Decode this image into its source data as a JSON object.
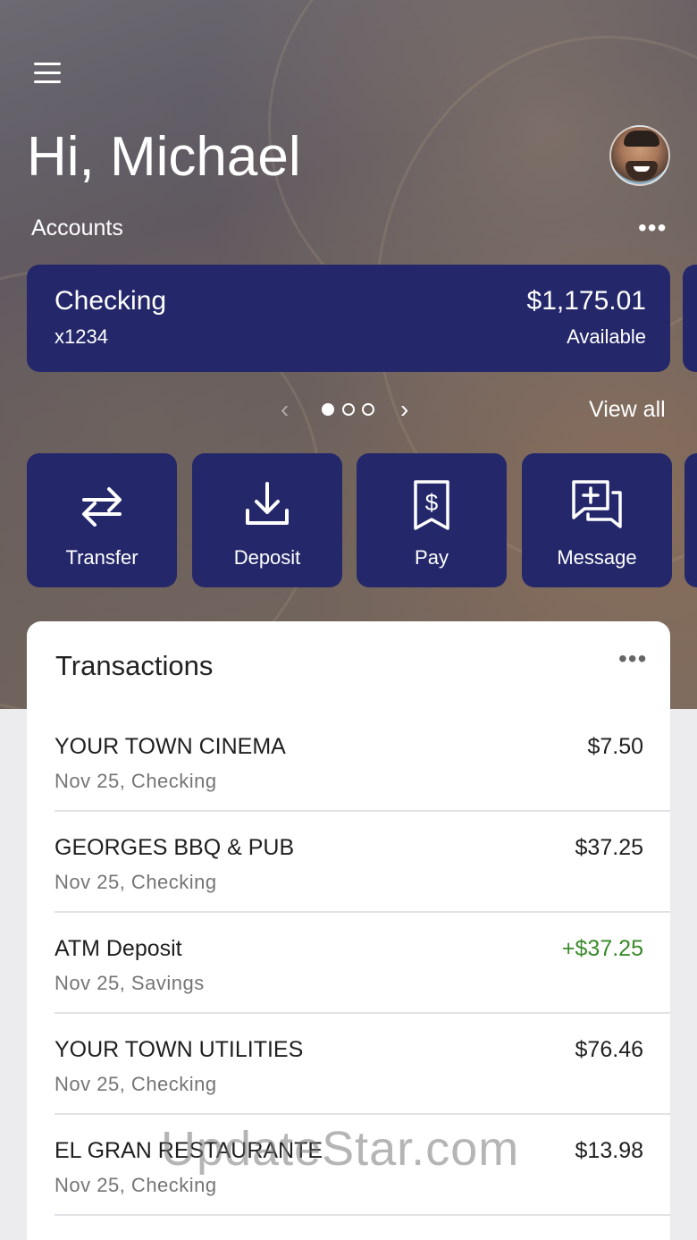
{
  "header": {
    "greeting": "Hi, Michael",
    "menu_icon": "hamburger-menu-icon",
    "avatar_icon": "profile-avatar"
  },
  "accounts": {
    "label": "Accounts",
    "more_icon": "more-horizontal-icon",
    "current": {
      "name": "Checking",
      "number": "x1234",
      "balance": "$1,175.01",
      "balance_label": "Available"
    },
    "pager": {
      "page": 1,
      "total": 3
    },
    "view_all": "View all"
  },
  "actions": [
    {
      "label": "Transfer",
      "icon": "transfer-arrows-icon"
    },
    {
      "label": "Deposit",
      "icon": "download-deposit-icon"
    },
    {
      "label": "Pay",
      "icon": "dollar-receipt-icon"
    },
    {
      "label": "Message",
      "icon": "message-plus-icon"
    }
  ],
  "transactions": {
    "title": "Transactions",
    "items": [
      {
        "merchant": "YOUR TOWN CINEMA",
        "sub": "Nov 25, Checking",
        "amount": "$7.50",
        "credit": false
      },
      {
        "merchant": "GEORGES BBQ & PUB",
        "sub": "Nov 25, Checking",
        "amount": "$37.25",
        "credit": false
      },
      {
        "merchant": "ATM Deposit",
        "sub": "Nov 25, Savings",
        "amount": "+$37.25",
        "credit": true
      },
      {
        "merchant": "YOUR TOWN UTILITIES",
        "sub": "Nov 25, Checking",
        "amount": "$76.46",
        "credit": false
      },
      {
        "merchant": "EL GRAN RESTAURANTE",
        "sub": "Nov 25, Checking",
        "amount": "$13.98",
        "credit": false
      }
    ]
  },
  "colors": {
    "card_navy": "#24286a",
    "credit_green": "#3a8a2a"
  },
  "watermark": "UpdateStar.com"
}
